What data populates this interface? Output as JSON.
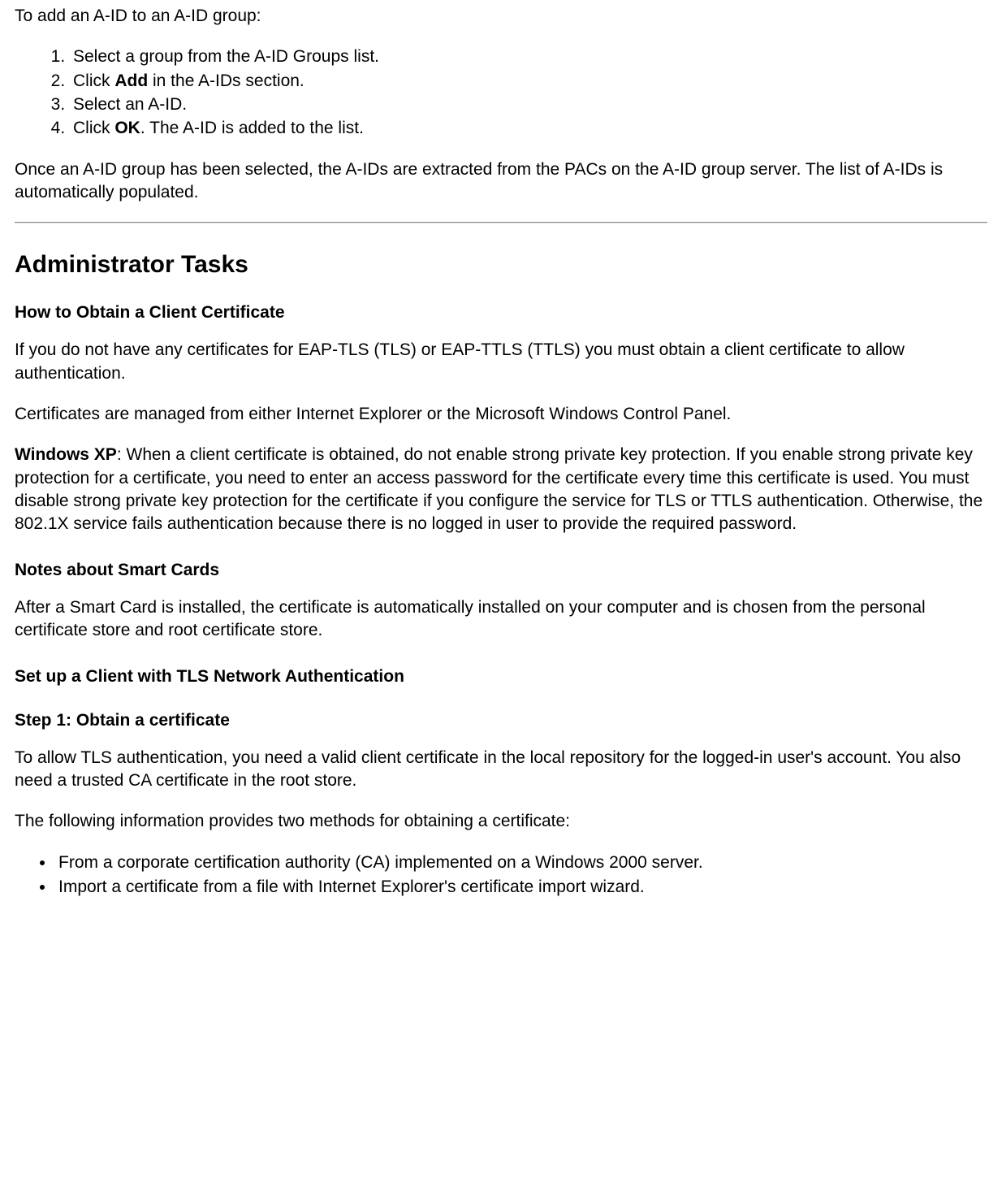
{
  "intro": "To add an A-ID to an A-ID group:",
  "steps": {
    "s1": "Select a group from the A-ID Groups list.",
    "s2_pre": "Click ",
    "s2_bold": "Add",
    "s2_post": " in the A-IDs section.",
    "s3": "Select an A-ID.",
    "s4_pre": "Click ",
    "s4_bold": "OK",
    "s4_post": ". The A-ID is added to the list."
  },
  "after_steps": "Once an A-ID group has been selected, the A-IDs are extracted from the PACs on the A-ID group server. The list of A-IDs is automatically populated.",
  "section_heading": "Administrator Tasks",
  "sub1": "How to Obtain a Client Certificate",
  "p1": "If you do not have any certificates for EAP-TLS (TLS) or EAP-TTLS (TTLS) you must obtain a client certificate to allow authentication.",
  "p2": "Certificates are managed from either Internet Explorer or the Microsoft Windows Control Panel.",
  "p3_bold": "Windows XP",
  "p3_rest": ": When a client certificate is obtained, do not enable strong private key protection. If you enable strong private key protection for a certificate, you need to enter an access password for the certificate every time this certificate is used. You must disable strong private key protection for the certificate if you configure the service for TLS or TTLS authentication. Otherwise, the 802.1X service fails authentication because there is no logged in user to provide the required password.",
  "sub2": "Notes about Smart Cards",
  "p4": "After a Smart Card is installed, the certificate is automatically installed on your computer and is chosen from the personal certificate store and root certificate store.",
  "sub3": "Set up a Client with TLS Network Authentication",
  "sub4": "Step 1: Obtain a certificate",
  "p5": "To allow TLS authentication, you need a valid client certificate in the local repository for the logged-in user's account. You also need a trusted CA certificate in the root store.",
  "p6": "The following information provides two methods for obtaining a certificate:",
  "bullets": {
    "b1": "From a corporate certification authority (CA) implemented on a Windows 2000 server.",
    "b2": "Import a certificate from a file with Internet Explorer's certificate import wizard."
  }
}
